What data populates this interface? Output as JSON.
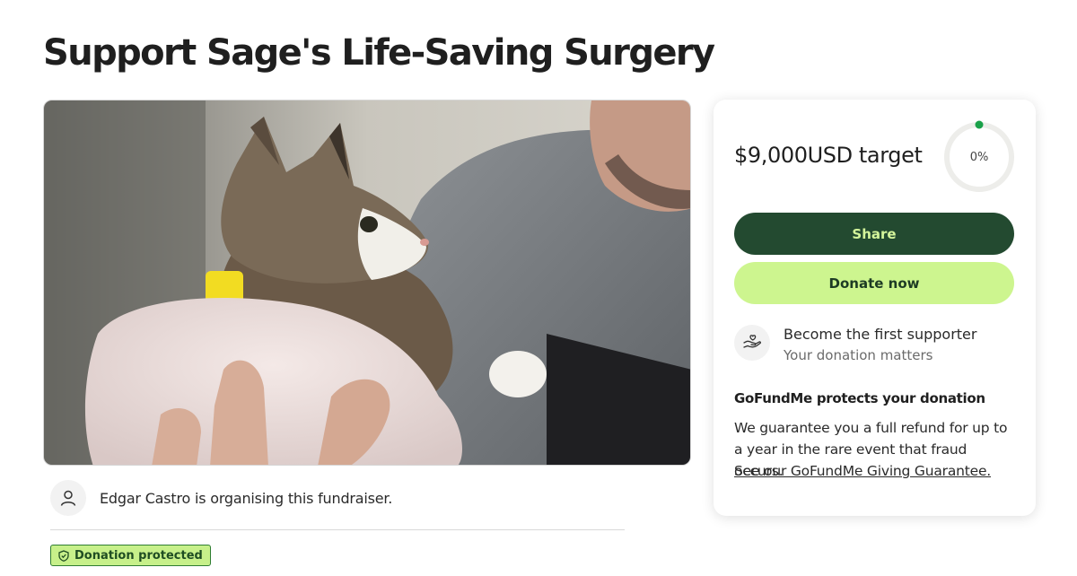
{
  "page": {
    "title": "Support Sage's Life-Saving Surgery"
  },
  "hero": {
    "image_description": "cat-held-in-towel-photo"
  },
  "organiser": {
    "text": "Edgar Castro is organising this fundraiser."
  },
  "badge": {
    "label": "Donation protected"
  },
  "card": {
    "target": "$9,000USD target",
    "progress_label": "0%",
    "progress_fraction": 0,
    "share_label": "Share",
    "donate_label": "Donate now",
    "supporter_title": "Become the first supporter",
    "supporter_subtitle": "Your donation matters",
    "protect_title": "GoFundMe protects your donation",
    "protect_body": "We guarantee you a full refund for up to a year in the rare event that fraud occurs.",
    "protect_link": "See our GoFundMe Giving Guarantee."
  },
  "colors": {
    "brand_dark": "#234a30",
    "brand_light": "#cdf58f",
    "progress_dot": "#1aa14a"
  }
}
